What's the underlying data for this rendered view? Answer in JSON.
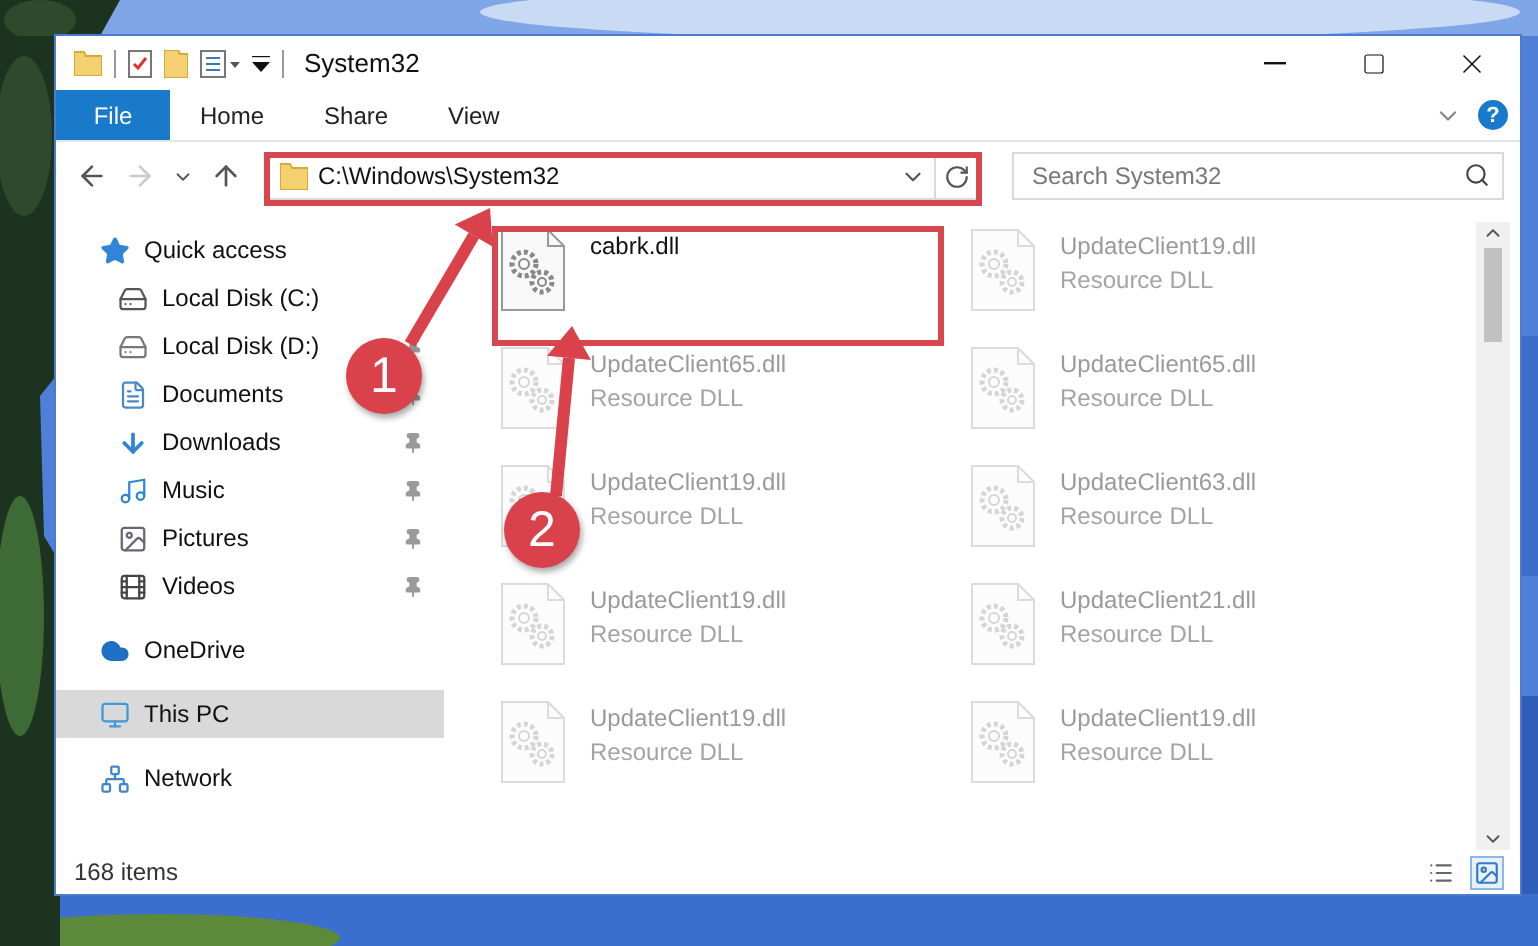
{
  "window": {
    "title": "System32",
    "quick_access_toolbar": [
      {
        "kind": "folder"
      },
      {
        "kind": "properties"
      },
      {
        "kind": "new-folder"
      },
      {
        "kind": "view"
      },
      {
        "kind": "customize"
      }
    ]
  },
  "ribbon": {
    "tabs": [
      {
        "label": "File",
        "kind": "file",
        "selected": false
      },
      {
        "label": "Home",
        "kind": "tab",
        "selected": false
      },
      {
        "label": "Share",
        "kind": "tab",
        "selected": false
      },
      {
        "label": "View",
        "kind": "tab",
        "selected": false
      }
    ],
    "help": "?"
  },
  "navigation": {
    "forward_disabled": true,
    "address": "C:\\Windows\\System32",
    "search": {
      "placeholder": "Search System32"
    }
  },
  "sidebar": {
    "items": [
      {
        "label": "Quick access",
        "kind": "star",
        "selected": false,
        "children": [
          {
            "label": "Local Disk (C:)",
            "kind": "system-drive",
            "pinned": false,
            "selected": false
          },
          {
            "label": "Local Disk (D:)",
            "kind": "drive",
            "pinned": true,
            "selected": false
          },
          {
            "label": "Documents",
            "kind": "documents",
            "pinned": true,
            "selected": false
          },
          {
            "label": "Downloads",
            "kind": "downloads",
            "pinned": true,
            "selected": false
          },
          {
            "label": "Music",
            "kind": "music",
            "pinned": true,
            "selected": false
          },
          {
            "label": "Pictures",
            "kind": "pictures",
            "pinned": true,
            "selected": false
          },
          {
            "label": "Videos",
            "kind": "videos",
            "pinned": true,
            "selected": false
          }
        ]
      },
      {
        "label": "OneDrive",
        "kind": "cloud",
        "selected": false
      },
      {
        "label": "This PC",
        "kind": "pc",
        "selected": true
      },
      {
        "label": "Network",
        "kind": "network",
        "selected": false
      }
    ]
  },
  "files": [
    {
      "name": "cabrk.dll",
      "dimmed": false
    },
    {
      "name": "UpdateClient19.dll",
      "type": "Resource DLL",
      "dimmed": true
    },
    {
      "name": "UpdateClient65.dll",
      "type": "Resource DLL",
      "dimmed": true
    },
    {
      "name": "UpdateClient65.dll",
      "type": "Resource DLL",
      "dimmed": true
    },
    {
      "name": "UpdateClient19.dll",
      "type": "Resource DLL",
      "dimmed": true
    },
    {
      "name": "UpdateClient63.dll",
      "type": "Resource DLL",
      "dimmed": true
    },
    {
      "name": "UpdateClient19.dll",
      "type": "Resource DLL",
      "dimmed": true
    },
    {
      "name": "UpdateClient21.dll",
      "type": "Resource DLL",
      "dimmed": true
    },
    {
      "name": "UpdateClient19.dll",
      "type": "Resource DLL",
      "dimmed": true
    },
    {
      "name": "UpdateClient19.dll",
      "type": "Resource DLL",
      "dimmed": true
    }
  ],
  "status_bar": {
    "count": "168 items",
    "views": [
      {
        "kind": "details",
        "selected": false
      },
      {
        "kind": "large-icons",
        "selected": true
      }
    ]
  },
  "annotations": [
    {
      "number": "1",
      "kind": "address"
    },
    {
      "number": "2",
      "kind": "file"
    }
  ]
}
